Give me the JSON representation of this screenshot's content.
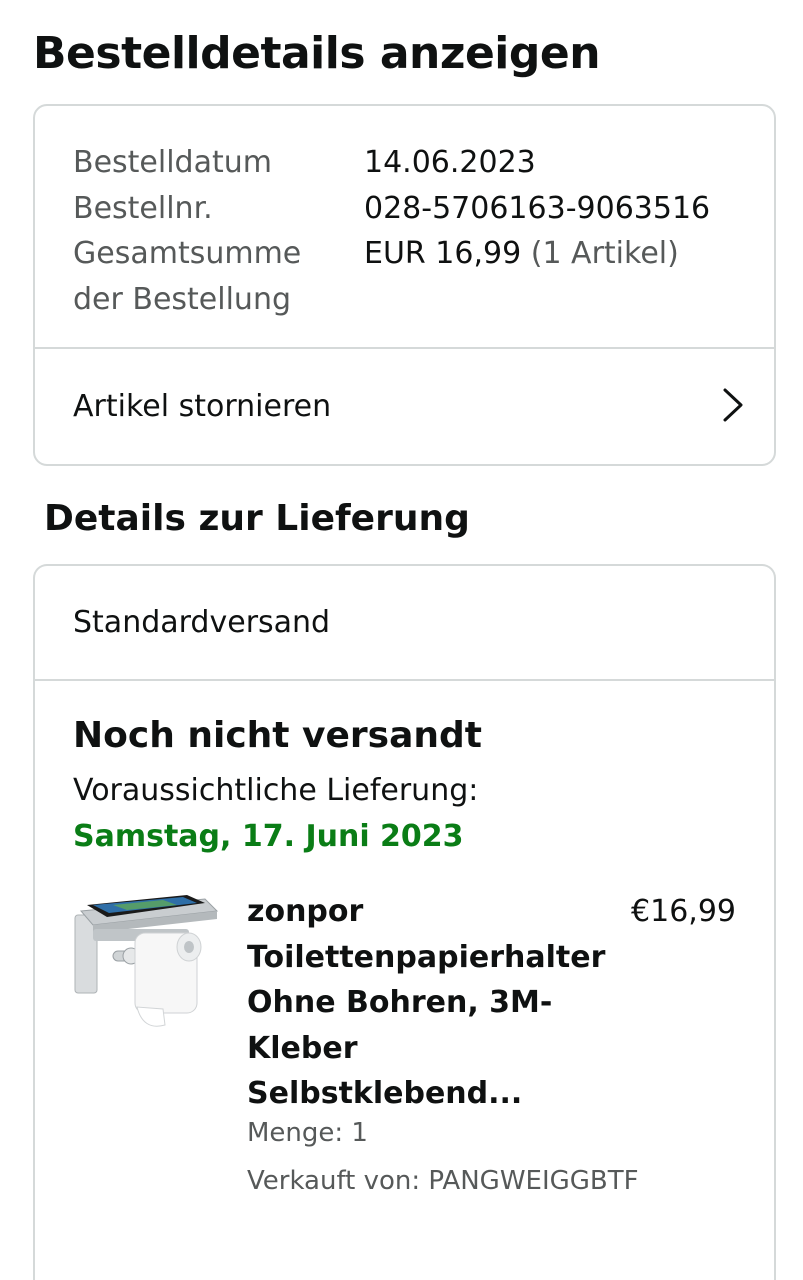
{
  "page_title": "Bestelldetails anzeigen",
  "order_summary": {
    "rows": [
      {
        "label": "Bestelldatum",
        "value": "14.06.2023",
        "value_extra": ""
      },
      {
        "label": "Bestellnr.",
        "value": "028-5706163-9063516",
        "value_extra": ""
      },
      {
        "label": "Gesamtsumme",
        "label_line2": "der Bestellung",
        "value": "EUR 16,99",
        "value_extra": "(1 Artikel)"
      }
    ],
    "cancel_label": "Artikel stornieren",
    "cancel_icon": "chevron-right-icon"
  },
  "delivery": {
    "section_title": "Details zur Lieferung",
    "shipping_method": "Standardversand",
    "status": "Noch nicht versandt",
    "eta_label": "Voraussichtliche Lieferung:",
    "eta_date": "Samstag, 17. Juni 2023",
    "eta_color": "#0a7d16",
    "item": {
      "image_icon": "toilet-paper-holder-product-image",
      "title": "zonpor Toilettenpapierhalter Ohne Bohren, 3M-Kleber Selbstklebend...",
      "price": "€16,99",
      "quantity": "Menge: 1",
      "seller": "Verkauft von: PANGWEIGGBTF"
    }
  }
}
